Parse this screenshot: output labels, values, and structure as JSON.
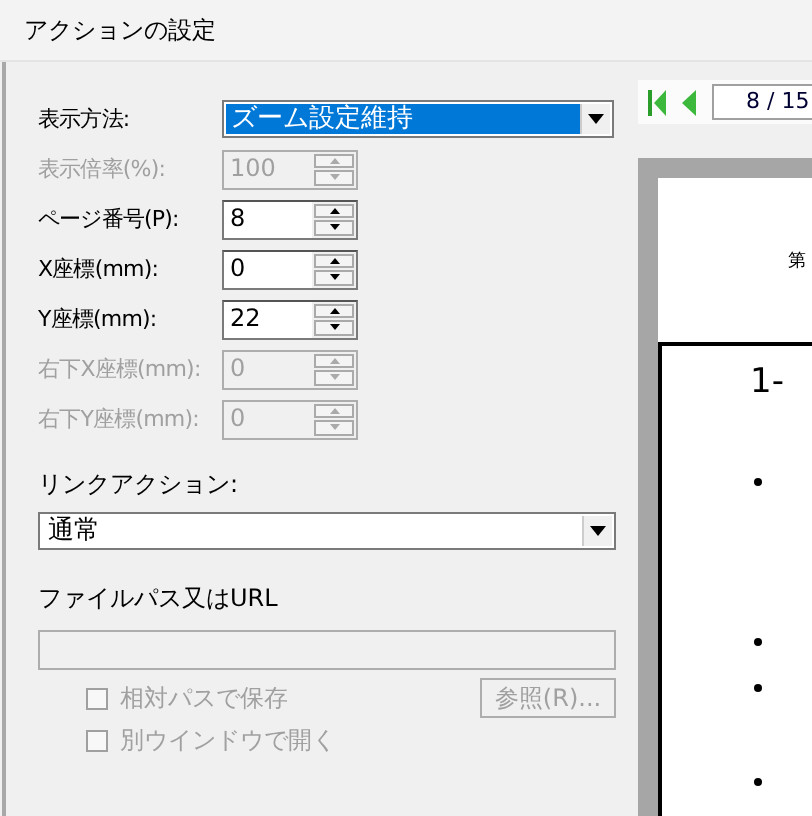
{
  "window": {
    "title": "アクションの設定"
  },
  "display_method": {
    "label": "表示方法:",
    "value": "ズーム設定維持",
    "highlighted": true
  },
  "spin_fields": [
    {
      "label": "表示倍率(%):",
      "value": "100",
      "disabled": true
    },
    {
      "label": "ページ番号(P):",
      "value": "8",
      "disabled": false
    },
    {
      "label": "X座標(mm):",
      "value": "0",
      "disabled": false
    },
    {
      "label": "Y座標(mm):",
      "value": "22",
      "disabled": false
    },
    {
      "label": "右下X座標(mm):",
      "value": "0",
      "disabled": true
    },
    {
      "label": "右下Y座標(mm):",
      "value": "0",
      "disabled": true
    }
  ],
  "link_action": {
    "label": "リンクアクション:",
    "value": "通常"
  },
  "file_path": {
    "label": "ファイルパス又はURL",
    "disabled": true
  },
  "checkboxes": [
    {
      "label": "相対パスで保存",
      "checked": false,
      "disabled": true
    },
    {
      "label": "別ウインドウで開く",
      "checked": false,
      "disabled": true
    }
  ],
  "browse_button": {
    "label": "参照(R)...",
    "disabled": true
  },
  "preview": {
    "page_field": "8 / 15",
    "header_text": "第",
    "heading": "1-"
  }
}
